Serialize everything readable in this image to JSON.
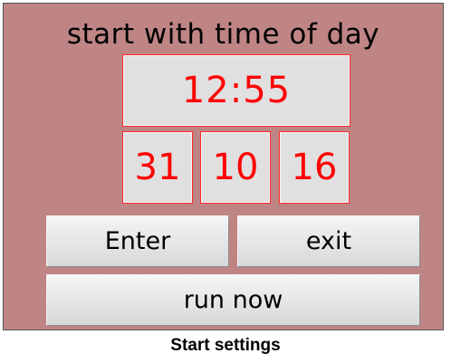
{
  "panel": {
    "title": "start with time of day",
    "time": "12:55",
    "date": {
      "day": "31",
      "month": "10",
      "year": "16"
    },
    "buttons": {
      "enter": "Enter",
      "exit": "exit",
      "run_now": "run now"
    }
  },
  "caption": "Start settings",
  "colors": {
    "panel_background": "#bf8585",
    "field_background": "#e0e0e0",
    "field_text": "#ff0000",
    "field_border": "#ff2a2a"
  }
}
